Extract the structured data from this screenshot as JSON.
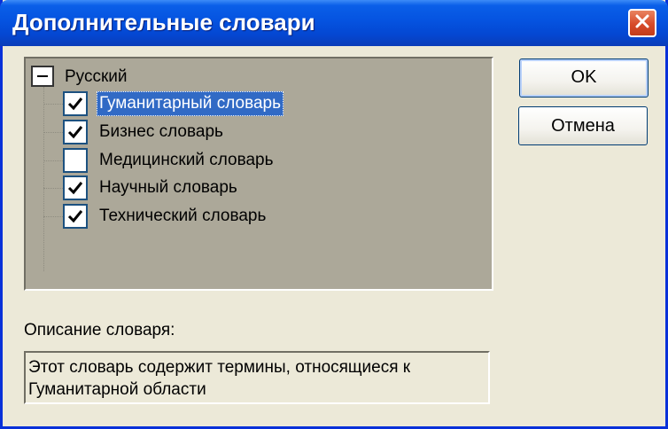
{
  "window": {
    "title": "Дополнительные словари"
  },
  "tree": {
    "root": {
      "label": "Русский",
      "expanded": true
    },
    "items": [
      {
        "label": "Гуманитарный словарь",
        "checked": true,
        "selected": true
      },
      {
        "label": "Бизнес словарь",
        "checked": true,
        "selected": false
      },
      {
        "label": "Медицинский словарь",
        "checked": false,
        "selected": false
      },
      {
        "label": "Научный словарь",
        "checked": true,
        "selected": false
      },
      {
        "label": "Технический словарь",
        "checked": true,
        "selected": false
      }
    ]
  },
  "buttons": {
    "ok_label": "OK",
    "cancel_label": "Отмена"
  },
  "description": {
    "label": "Описание словаря:",
    "text": "Этот словарь содержит термины, относящиеся к Гуманитарной области"
  },
  "icons": {
    "close": "close-icon",
    "check": "checkmark-icon",
    "collapse": "minus-icon"
  },
  "colors": {
    "titlebar": "#0553E0",
    "selection": "#316AC5",
    "dialog_bg": "#ECE9D8",
    "tree_bg": "#ACA899",
    "close_button": "#D74B2A"
  }
}
